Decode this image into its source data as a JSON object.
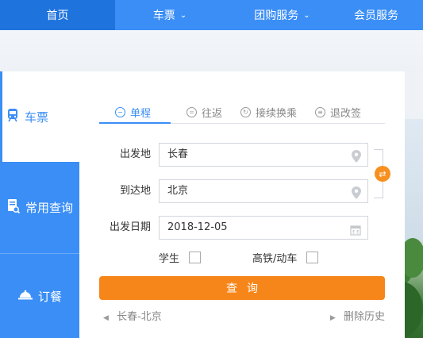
{
  "nav": {
    "items": [
      {
        "label": "首页",
        "dropdown": false
      },
      {
        "label": "车票",
        "dropdown": true
      },
      {
        "label": "团购服务",
        "dropdown": true
      },
      {
        "label": "会员服务",
        "dropdown": false
      }
    ]
  },
  "sidebar": {
    "tabs": [
      {
        "label": "车票",
        "icon": "train-icon"
      },
      {
        "label": "常用查询",
        "icon": "document-search-icon"
      },
      {
        "label": "订餐",
        "icon": "food-cloche-icon"
      }
    ]
  },
  "trip_tabs": [
    {
      "label": "单程",
      "icon": "minus-circle-icon"
    },
    {
      "label": "往返",
      "icon": "equals-circle-icon"
    },
    {
      "label": "接续换乘",
      "icon": "refresh-circle-icon"
    },
    {
      "label": "退改签",
      "icon": "stack-circle-icon"
    }
  ],
  "form": {
    "from_label": "出发地",
    "from_value": "长春",
    "to_label": "到达地",
    "to_value": "北京",
    "date_label": "出发日期",
    "date_value": "2018-12-05",
    "student_label": "学生",
    "hsr_label": "高铁/动车"
  },
  "search_button": "查询",
  "history": {
    "last_route": "长春-北京",
    "clear_label": "删除历史"
  },
  "colors": {
    "primary": "#3a8ef6",
    "nav_active": "#1f73dd",
    "accent": "#f7861a"
  }
}
